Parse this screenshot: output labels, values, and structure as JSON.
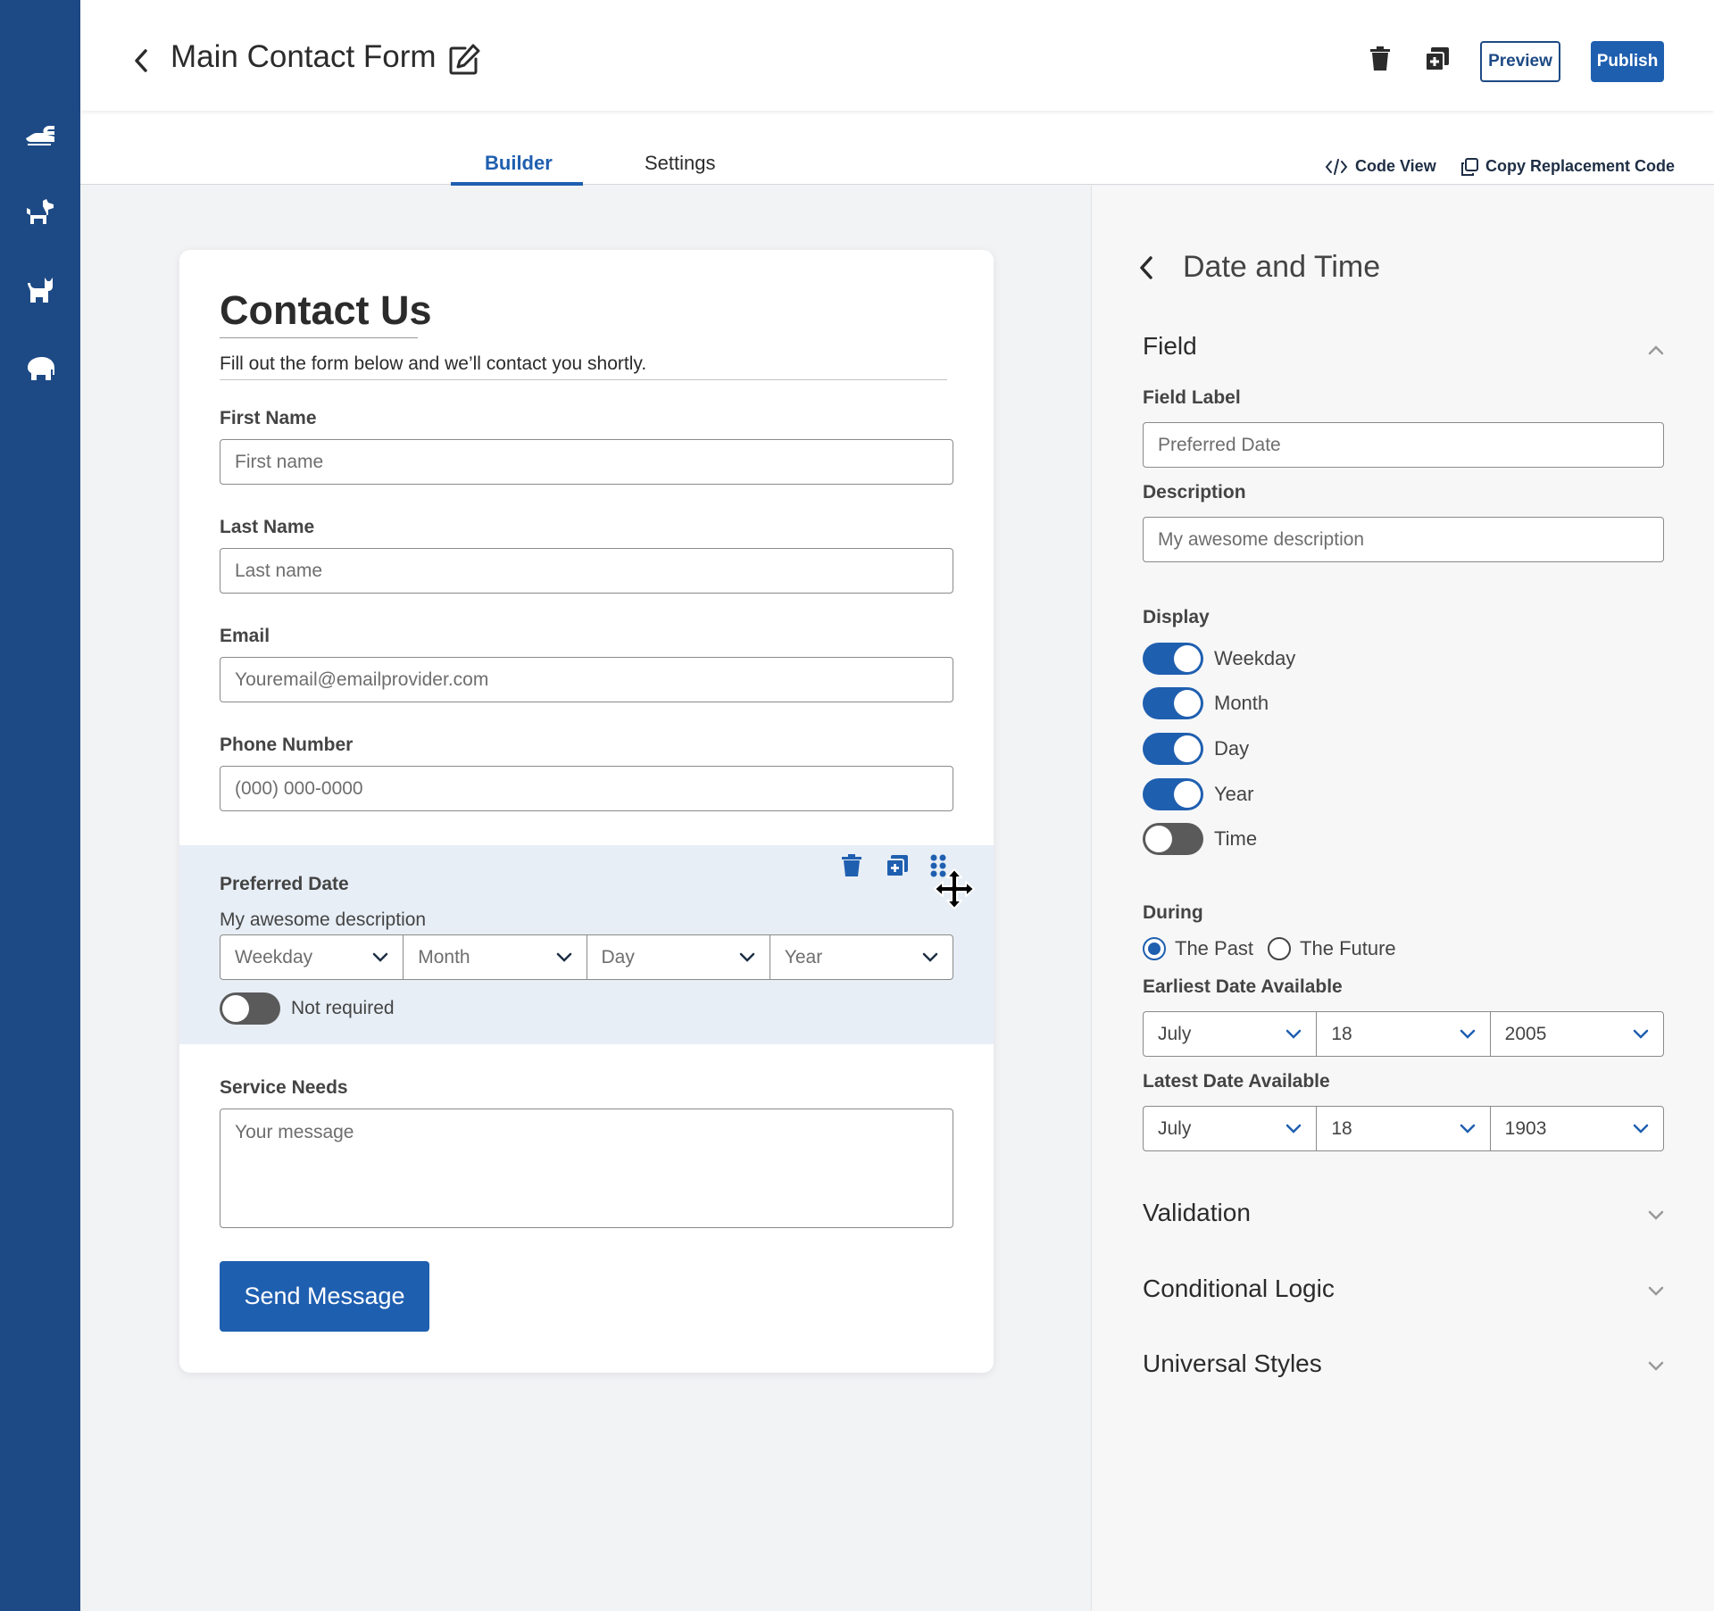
{
  "header": {
    "title": "Main Contact Form",
    "preview_label": "Preview",
    "publish_label": "Publish"
  },
  "sidebar": {
    "items": [
      {
        "icon": "hand-icon"
      },
      {
        "icon": "dog-icon"
      },
      {
        "icon": "cat-icon"
      },
      {
        "icon": "elephant-icon"
      }
    ]
  },
  "tabs": {
    "builder": "Builder",
    "settings": "Settings",
    "code_view": "Code View",
    "copy_code": "Copy Replacement Code"
  },
  "form": {
    "title": "Contact Us",
    "subtitle": "Fill out the form below and we’ll contact you shortly.",
    "first_name": {
      "label": "First Name",
      "placeholder": "First name"
    },
    "last_name": {
      "label": "Last Name",
      "placeholder": "Last name"
    },
    "email": {
      "label": "Email",
      "placeholder": "Youremail@emailprovider.com"
    },
    "phone": {
      "label": "Phone Number",
      "placeholder": "(000) 000-0000"
    },
    "preferred_date": {
      "label": "Preferred Date",
      "description": "My awesome description",
      "selects": [
        "Weekday",
        "Month",
        "Day",
        "Year"
      ],
      "required_label": "Not required"
    },
    "service_needs": {
      "label": "Service Needs",
      "placeholder": "Your message"
    },
    "submit_label": "Send Message"
  },
  "panel": {
    "title": "Date and Time",
    "field_section": "Field",
    "field_label_label": "Field Label",
    "field_label_value": "Preferred Date",
    "description_label": "Description",
    "description_value": "My awesome description",
    "display_label": "Display",
    "display_options": [
      {
        "label": "Weekday",
        "on": true
      },
      {
        "label": "Month",
        "on": true
      },
      {
        "label": "Day",
        "on": true
      },
      {
        "label": "Year",
        "on": true
      },
      {
        "label": "Time",
        "on": false
      }
    ],
    "during_label": "During",
    "during_options": [
      "The Past",
      "The Future"
    ],
    "during_selected": "The Past",
    "earliest_label": "Earliest Date Available",
    "earliest": {
      "month": "July",
      "day": "18",
      "year": "2005"
    },
    "latest_label": "Latest Date Available",
    "latest": {
      "month": "July",
      "day": "18",
      "year": "1903"
    },
    "validation": "Validation",
    "conditional_logic": "Conditional Logic",
    "universal_styles": "Universal Styles"
  },
  "colors": {
    "sidebar": "#1d4a85",
    "accent": "#1f5fb0",
    "selected_field_bg": "#e8eef6"
  }
}
